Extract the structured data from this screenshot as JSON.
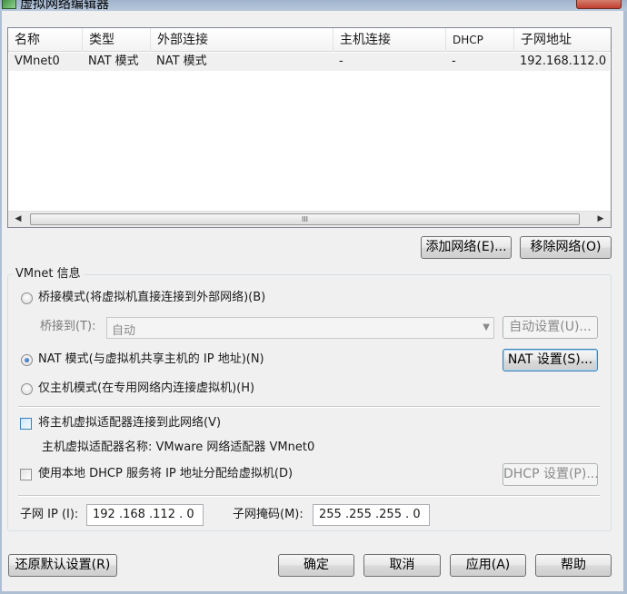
{
  "window": {
    "title": "虚拟网络编辑器"
  },
  "table": {
    "columns": [
      "名称",
      "类型",
      "外部连接",
      "主机连接",
      "DHCP",
      "子网地址"
    ],
    "rows": [
      [
        "VMnet0",
        "NAT 模式",
        "NAT 模式",
        "-",
        "-",
        "192.168.112.0"
      ]
    ],
    "scroll_grip": "III"
  },
  "buttons": {
    "add_network": "添加网络(E)...",
    "remove_network": "移除网络(O)",
    "auto_settings": "自动设置(U)...",
    "nat_settings": "NAT 设置(S)...",
    "dhcp_settings": "DHCP 设置(P)...",
    "restore_defaults": "还原默认设置(R)",
    "ok": "确定",
    "cancel": "取消",
    "apply": "应用(A)",
    "help": "帮助"
  },
  "vmnet_info": {
    "legend": "VMnet 信息",
    "bridged_label": "桥接模式(将虚拟机直接连接到外部网络)(B)",
    "bridged_to_label": "桥接到(T):",
    "bridged_to_value": "自动",
    "nat_label": "NAT 模式(与虚拟机共享主机的 IP 地址)(N)",
    "host_only_label": "仅主机模式(在专用网络内连接虚拟机)(H)",
    "selected_mode": "nat",
    "connect_adapter_label": "将主机虚拟适配器连接到此网络(V)",
    "connect_adapter_checked": false,
    "adapter_name_text": "主机虚拟适配器名称: VMware 网络适配器 VMnet0",
    "dhcp_label": "使用本地 DHCP 服务将 IP 地址分配给虚拟机(D)",
    "dhcp_checked": false,
    "subnet_ip_label": "子网 IP (I):",
    "subnet_ip_value": "192 .168 .112 .  0",
    "subnet_mask_label": "子网掩码(M):",
    "subnet_mask_value": "255 .255 .255 .  0"
  },
  "colors": {
    "window_bg": "#f0f0f0",
    "titlebar": "#b8c9dc",
    "selection_row": "#f0f0f0",
    "accent": "#3c7fb1"
  }
}
